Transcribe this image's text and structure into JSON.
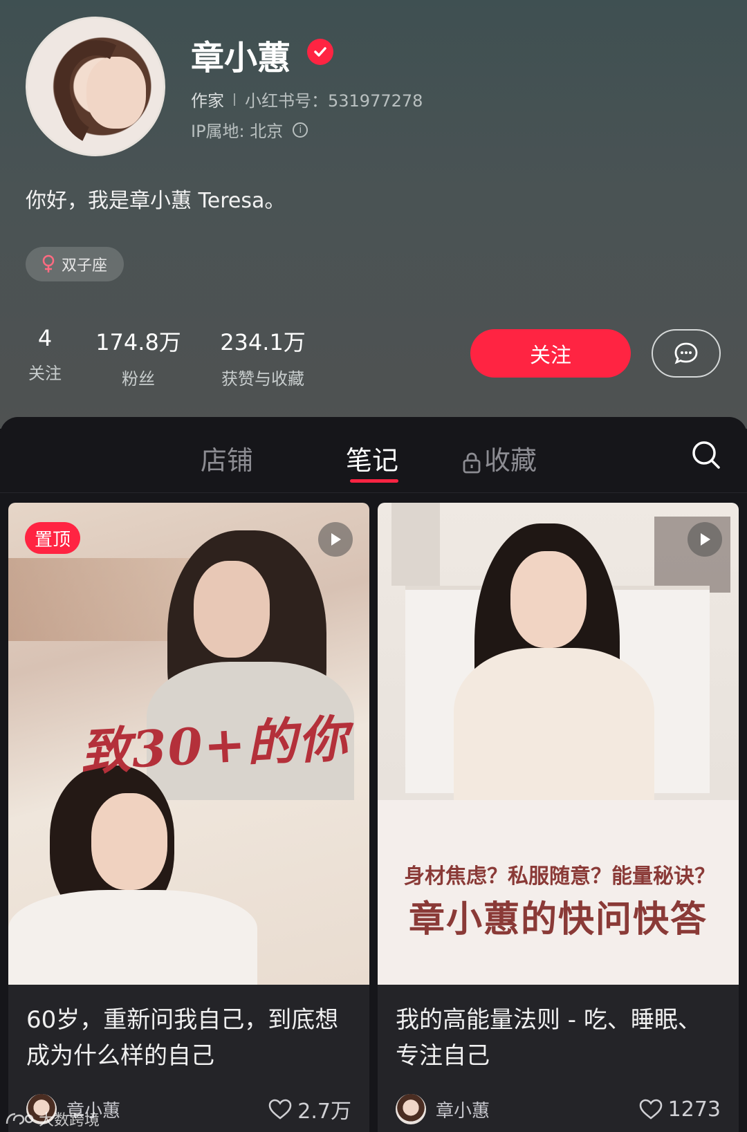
{
  "profile": {
    "name": "章小蕙",
    "occupation": "作家",
    "id_label": "小红书号：531977278",
    "ip_label": "IP属地: 北京",
    "bio": "你好，我是章小蕙 Teresa。",
    "tag": "双子座",
    "stats": [
      {
        "value": "4",
        "label": "关注"
      },
      {
        "value": "174.8万",
        "label": "粉丝"
      },
      {
        "value": "234.1万",
        "label": "获赞与收藏"
      }
    ],
    "follow_label": "关注"
  },
  "tabs": [
    {
      "label": "店铺"
    },
    {
      "label": "笔记"
    },
    {
      "label": "收藏"
    }
  ],
  "active_tab": "笔记",
  "notes": [
    {
      "badge": "置顶",
      "cover_text": "致30+的你",
      "title": "60岁，重新问我自己，到底想成为什么样的自己",
      "author": "章小蕙",
      "likes": "2.7万"
    },
    {
      "cover_subtext": "身材焦虑？私服随意？能量秘诀？",
      "cover_text": "章小蕙的快问快答",
      "title": "我的高能量法则 - 吃、睡眠、专注自己",
      "author": "章小蕙",
      "likes": "1273"
    }
  ],
  "watermark": "大数跨境",
  "colors": {
    "accent": "#ff2442",
    "header_bg": "#4a5354",
    "panel_bg": "#16161a"
  }
}
